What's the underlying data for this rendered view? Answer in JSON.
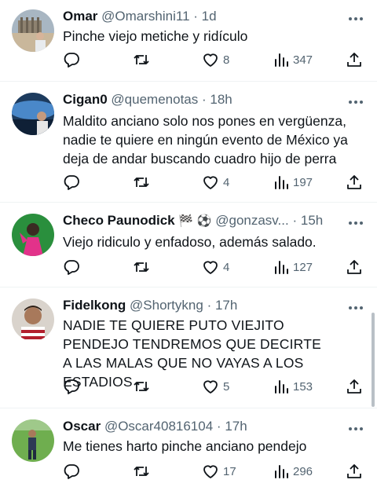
{
  "tweets": [
    {
      "name": "Omar",
      "handle": "@Omarshini11",
      "time": "1d",
      "text": "Pinche viejo metiche y ridículo",
      "stats": {
        "replies": "",
        "retweets": "",
        "likes": "8",
        "views": "347"
      },
      "avatar_colors": [
        "#c9b79b",
        "#6e7f8e"
      ]
    },
    {
      "name": "Cigan0",
      "handle": "@quemenotas",
      "time": "18h",
      "text": "Maldito anciano solo nos pones en vergüenza, nadie te quiere en ningún evento de México ya deja de andar buscando cuadro hijo de perra",
      "stats": {
        "replies": "",
        "retweets": "",
        "likes": "4",
        "views": "197"
      },
      "avatar_colors": [
        "#1d3b5e",
        "#4a88c9"
      ]
    },
    {
      "name": "Checo Paunodick",
      "emoji": "🏁 ⚽",
      "handle": "@gonzasv...",
      "time": "15h",
      "text": "Viejo ridiculo y enfadoso, además salado.",
      "stats": {
        "replies": "",
        "retweets": "",
        "likes": "4",
        "views": "127"
      },
      "avatar_colors": [
        "#2a8f3d",
        "#e2328a"
      ]
    },
    {
      "name": "Fidelkong",
      "handle": "@Shortykng",
      "time": "17h",
      "text": "NADIE TE QUIERE PUTO VIEJITO PENDEJO TENDREMOS QUE DECIRTE A LAS MALAS QUE NO VAYAS A LOS ESTADIOS",
      "stats": {
        "replies": "",
        "retweets": "",
        "likes": "5",
        "views": "153"
      },
      "avatar_colors": [
        "#d9d3cc",
        "#b21f2d"
      ]
    },
    {
      "name": "Oscar",
      "handle": "@Oscar40816104",
      "time": "17h",
      "text": "Me tienes harto pinche anciano pendejo",
      "stats": {
        "replies": "",
        "retweets": "",
        "likes": "17",
        "views": "296"
      },
      "avatar_colors": [
        "#6fae4f",
        "#2d3a55"
      ]
    }
  ],
  "dot": "·",
  "icons": {
    "reply": "reply-icon",
    "retweet": "retweet-icon",
    "like": "heart-icon",
    "views": "views-icon",
    "share": "share-icon",
    "more": "more-icon"
  },
  "colors": {
    "secondary_text": "#536471",
    "primary_text": "#0f1419",
    "divider": "#eff3f4"
  }
}
